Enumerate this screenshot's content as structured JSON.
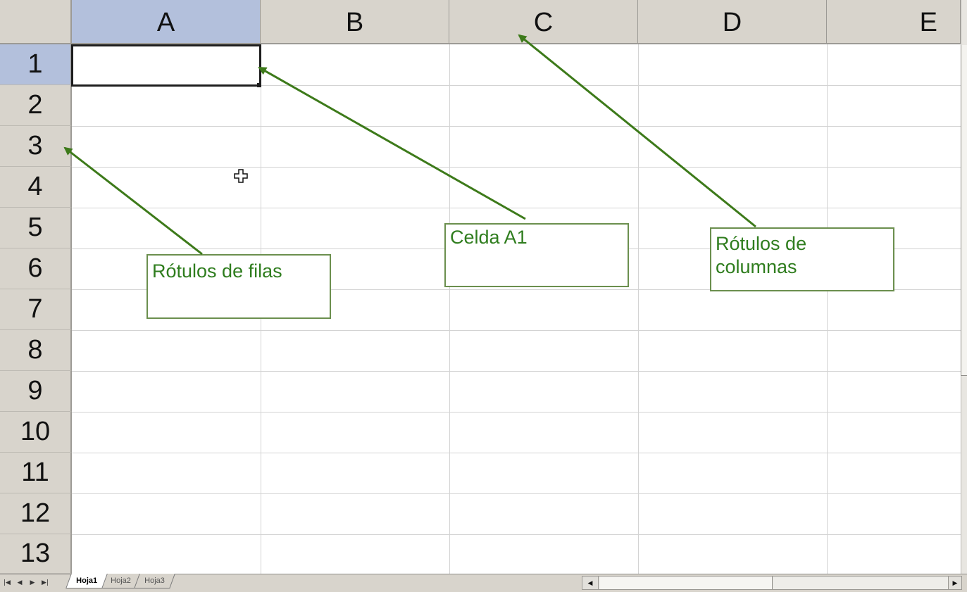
{
  "spreadsheet": {
    "columns": [
      "A",
      "B",
      "C",
      "D",
      "E"
    ],
    "rows": [
      "1",
      "2",
      "3",
      "4",
      "5",
      "6",
      "7",
      "8",
      "9",
      "10",
      "11",
      "12",
      "13"
    ],
    "selected_column": "A",
    "selected_row": "1",
    "active_cell": "A1"
  },
  "sheet_tabs": [
    "Hoja1",
    "Hoja2",
    "Hoja3"
  ],
  "active_tab": "Hoja1",
  "annotations": {
    "row_labels": "Rótulos de filas",
    "cell_a1": "Celda A1",
    "column_labels_line1": "Rótulos de",
    "column_labels_line2": "columnas"
  },
  "icons": {
    "cursor": "cross-cursor-icon",
    "nav_first": "first-sheet-icon",
    "nav_prev": "prev-sheet-icon",
    "nav_next": "next-sheet-icon",
    "nav_last": "last-sheet-icon"
  },
  "colors": {
    "annotation_green": "#2f7d1e",
    "arrow_green": "#3d7a1a",
    "header_bg": "#d8d4cc",
    "header_selected": "#b3c0dc"
  }
}
